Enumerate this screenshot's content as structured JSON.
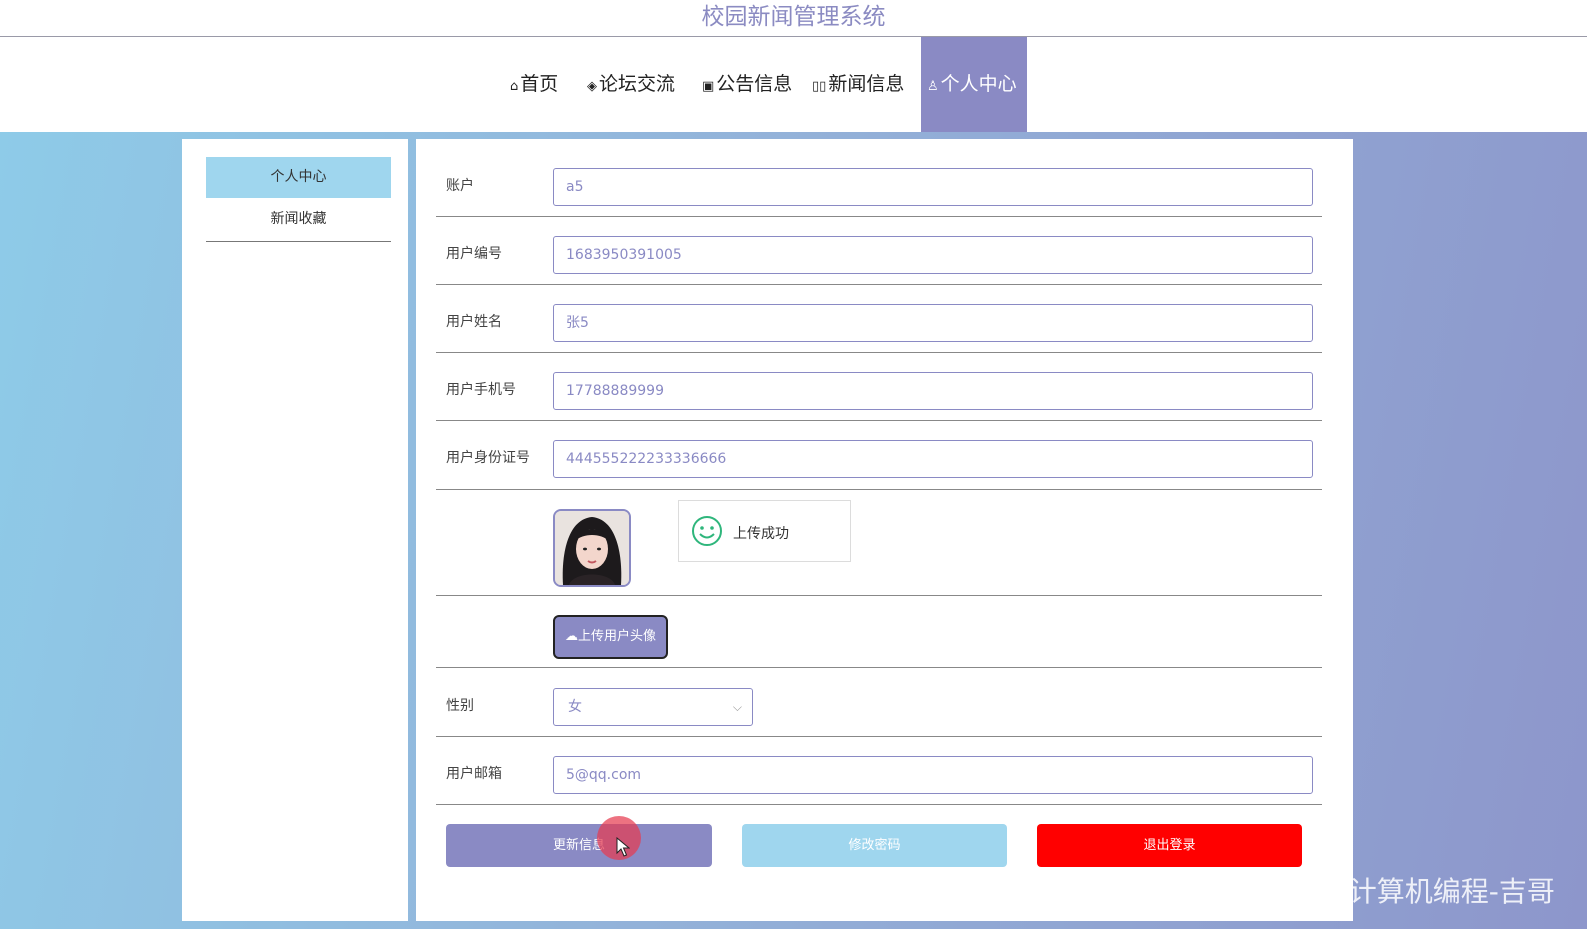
{
  "header": {
    "title": "校园新闻管理系统"
  },
  "nav": {
    "items": [
      {
        "icon": "home-icon",
        "label": "首页"
      },
      {
        "icon": "layers-icon",
        "label": "论坛交流"
      },
      {
        "icon": "gift-icon",
        "label": "公告信息"
      },
      {
        "icon": "book-icon",
        "label": "新闻信息"
      },
      {
        "icon": "user-icon",
        "label": "个人中心",
        "active": true
      }
    ]
  },
  "sidebar": {
    "items": [
      {
        "label": "个人中心",
        "active": true
      },
      {
        "label": "新闻收藏"
      }
    ]
  },
  "form": {
    "account": {
      "label": "账户",
      "value": "a5"
    },
    "user_no": {
      "label": "用户编号",
      "value": "1683950391005"
    },
    "user_name": {
      "label": "用户姓名",
      "value": "张5"
    },
    "phone": {
      "label": "用户手机号",
      "value": "17788889999"
    },
    "id_card": {
      "label": "用户身份证号",
      "value": "444555222233336666"
    },
    "upload_toast": "上传成功",
    "upload_button": "上传用户头像",
    "gender": {
      "label": "性别",
      "value": "女"
    },
    "email": {
      "label": "用户邮箱",
      "value": "5@qq.com"
    }
  },
  "actions": {
    "update": "更新信息",
    "change_password": "修改密码",
    "logout": "退出登录"
  },
  "watermark": "CSDN @计算机编程-吉哥",
  "colors": {
    "accent": "#8a8ac4",
    "light_blue": "#9fd6ee",
    "danger": "#ff0000",
    "success": "#2fb67c"
  }
}
